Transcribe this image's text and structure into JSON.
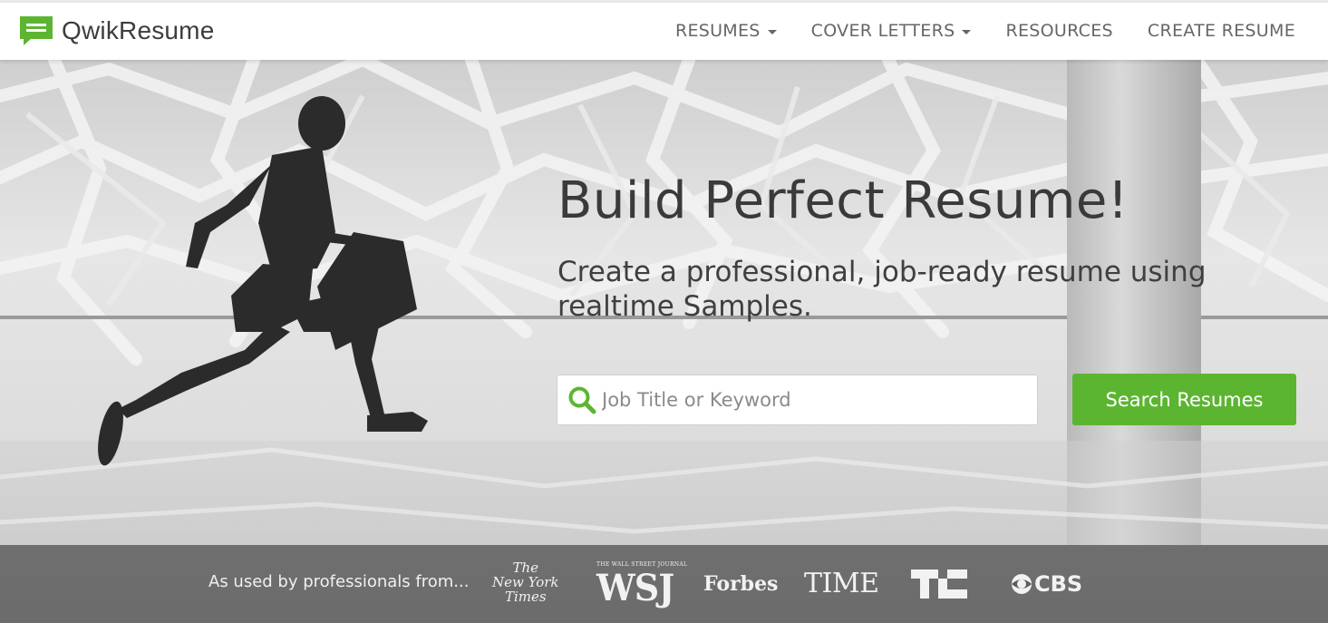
{
  "brand": {
    "name": "QwikResume",
    "accent": "#5cb531"
  },
  "nav": {
    "resumes": "RESUMES",
    "cover_letters": "COVER LETTERS",
    "resources": "RESOURCES",
    "create_resume": "CREATE RESUME"
  },
  "hero": {
    "title": "Build Perfect Resume!",
    "subtitle": "Create a professional, job-ready resume using realtime Samples.",
    "search_placeholder": "Job Title or Keyword",
    "search_button": "Search Resumes"
  },
  "press": {
    "label": "As used by professionals from...",
    "logos": {
      "nyt": [
        "The",
        "New York",
        "Times"
      ],
      "wsj_caption": "THE WALL STREET JOURNAL",
      "wsj": "WSJ",
      "forbes": "Forbes",
      "time": "TIME",
      "techcrunch": "TC",
      "cbs": "CBS"
    }
  }
}
